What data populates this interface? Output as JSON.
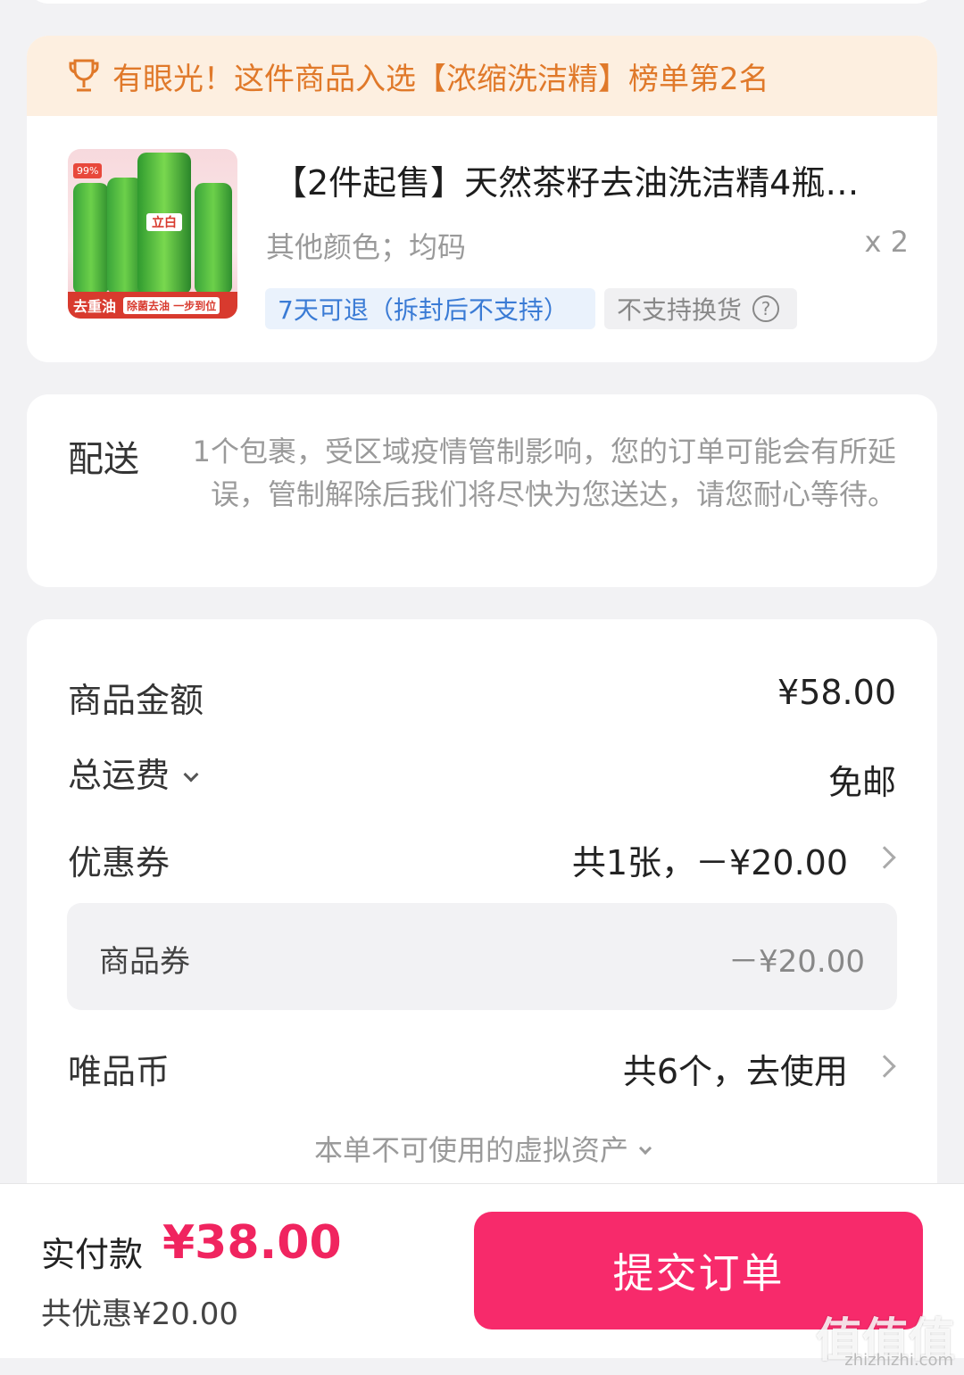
{
  "ranking_banner": {
    "text": "有眼光！这件商品入选【浓缩洗洁精】榜单第2名"
  },
  "product": {
    "title": "【2件起售】天然茶籽去油洗洁精4瓶…",
    "spec": "其他颜色；均码",
    "quantity": "x 2",
    "image_brand": "立白",
    "image_badge": "99%",
    "image_ribbon": "去重油",
    "image_ribbon_sub": "除菌去油 一步到位",
    "tags": {
      "return": "7天可退（拆封后不支持）",
      "exchange": "不支持换货"
    }
  },
  "delivery": {
    "label": "配送",
    "text": "1个包裹，受区域疫情管制影响，您的订单可能会有所延误，管制解除后我们将尽快为您送达，请您耐心等待。"
  },
  "price": {
    "goods_amount_label": "商品金额",
    "goods_amount_value": "¥58.00",
    "shipping_label": "总运费",
    "shipping_value": "免邮",
    "coupon_label": "优惠券",
    "coupon_value": "共1张，－¥20.00",
    "coupon_detail_label": "商品券",
    "coupon_detail_value": "－¥20.00",
    "coins_label": "唯品币",
    "coins_value": "共6个，去使用",
    "virtual_assets": "本单不可使用的虚拟资产"
  },
  "bottom": {
    "pay_label": "实付款",
    "pay_amount": "¥38.00",
    "discount_total": "共优惠¥20.00",
    "submit_label": "提交订单"
  },
  "watermark": {
    "text": "值值值",
    "url": "zhizhizhi.com"
  },
  "colors": {
    "accent": "#f72a6b",
    "price": "#f0245f",
    "banner": "#fdefe0",
    "banner_text": "#e0792a"
  }
}
